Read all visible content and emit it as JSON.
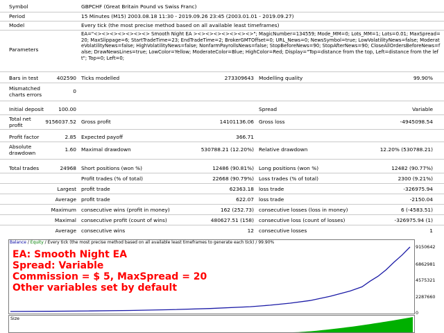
{
  "report": {
    "symbol_label": "Symbol",
    "symbol_value": "GBPCHF (Great Britain Pound vs Swiss Franc)",
    "period_label": "Period",
    "period_value": "15 Minutes (M15) 2003.08.18 11:30 - 2019.09.26 23:45 (2003.01.01 - 2019.09.27)",
    "model_label": "Model",
    "model_value": "Every tick (the most precise method based on all available least timeframes)",
    "parameters_label": "Parameters",
    "parameters_value": "EA=\"<><><><><><><> Smooth Night EA ><><><><><><><>\"; MagicNumber=134559; Mode_MM=0; Lots_MM=1; Lots=0.01; MaxSpread=20; MaxSlippage=6; StartTradeTime=23; EndTradeTime=2; BrokerGMTOffset=0; URL_News=0; NewsSymbol=true; LowVolatilityNews=false; ModerateVolatilityNews=false; HighVolatilityNews=false; NonfarmPayrollsNews=false; StopBeforeNews=90; StopAfterNews=90; CloseAllOrdersBeforeNews=false; DrawNewsLines=true; LowColor=Yellow; ModerateColor=Blue; HighColor=Red; Display=\"Top=distance from the top, Left=distance from the left\"; Top=0; Left=0;",
    "bars_label": "Bars in test",
    "bars_value": "402590",
    "ticks_label": "Ticks modelled",
    "ticks_value": "273309643",
    "quality_label": "Modelling quality",
    "quality_value": "99.90%",
    "mismatch_label": "Mismatched charts errors",
    "mismatch_value": "0",
    "deposit_label": "Initial deposit",
    "deposit_value": "100.00",
    "spread_label": "Spread",
    "spread_value": "Variable",
    "netprofit_label": "Total net profit",
    "netprofit_value": "9156037.52",
    "grossprofit_label": "Gross profit",
    "grossprofit_value": "14101136.06",
    "grossloss_label": "Gross loss",
    "grossloss_value": "-4945098.54",
    "pf_label": "Profit factor",
    "pf_value": "2.85",
    "payoff_label": "Expected payoff",
    "payoff_value": "366.71",
    "absdd_label": "Absolute drawdown",
    "absdd_value": "1.60",
    "maxdd_label": "Maximal drawdown",
    "maxdd_value": "530788.21 (12.20%)",
    "reldd_label": "Relative drawdown",
    "reldd_value": "12.20% (530788.21)",
    "trades_label": "Total trades",
    "trades_value": "24968",
    "short_label": "Short positions (won %)",
    "short_value": "12486 (90.81%)",
    "long_label": "Long positions (won %)",
    "long_value": "12482 (90.77%)",
    "ptrades_label": "Profit trades (% of total)",
    "ptrades_value": "22668 (90.79%)",
    "ltrades_label": "Loss trades (% of total)",
    "ltrades_value": "2300 (9.21%)",
    "largest_label": "Largest",
    "largest_profit_label": "profit trade",
    "largest_profit_value": "62363.18",
    "largest_loss_label": "loss trade",
    "largest_loss_value": "-326975.94",
    "average_label": "Average",
    "avg_profit_label": "profit trade",
    "avg_profit_value": "622.07",
    "avg_loss_label": "loss trade",
    "avg_loss_value": "-2150.04",
    "maximum_label": "Maximum",
    "max_wins_label": "consecutive wins (profit in money)",
    "max_wins_value": "162 (252.73)",
    "max_losses_label": "consecutive losses (loss in money)",
    "max_losses_value": "6 (-4583.51)",
    "maximal_label": "Maximal",
    "maximal_profit_label": "consecutive profit (count of wins)",
    "maximal_profit_value": "480627.51 (158)",
    "maximal_loss_label": "consecutive loss (count of losses)",
    "maximal_loss_value": "-326975.94 (1)",
    "average2_label": "Average",
    "avg_cwins_label": "consecutive wins",
    "avg_cwins_value": "12",
    "avg_closses_label": "consecutive losses",
    "avg_closses_value": "1"
  },
  "chart": {
    "header_balance": "Balance",
    "header_sep": " / ",
    "header_equity": "Equity",
    "header_rest": " / Every tick (the most precise method based on all available least timeframes to generate each tick) / 99.90%",
    "overlay_line1": "EA: Smooth Night EA",
    "overlay_line2": "Spread: Variable",
    "overlay_line3": "Commission = $ 5, MaxSpread = 20",
    "overlay_line4": "Other variables set by default",
    "y_labels": [
      "9150642",
      "6862981",
      "4575321",
      "2287660",
      "0"
    ],
    "size_label": "Size",
    "balance_color": "#1a1aa6",
    "equity_color": "#00a000",
    "size_color": "#00b000"
  },
  "chart_data": {
    "type": "line",
    "series": [
      {
        "name": "Balance",
        "x": [
          0,
          0.1,
          0.2,
          0.3,
          0.4,
          0.5,
          0.6,
          0.65,
          0.7,
          0.75,
          0.8,
          0.85,
          0.88,
          0.9,
          0.92,
          0.94,
          0.96,
          0.98,
          1.0
        ],
        "values": [
          0,
          30000,
          80000,
          150000,
          260000,
          420000,
          680000,
          900000,
          1180000,
          1550000,
          2150000,
          2900000,
          3500000,
          4300000,
          5000000,
          5900000,
          7000000,
          8000000,
          9150642
        ]
      }
    ],
    "ylim": [
      0,
      9150642
    ]
  }
}
